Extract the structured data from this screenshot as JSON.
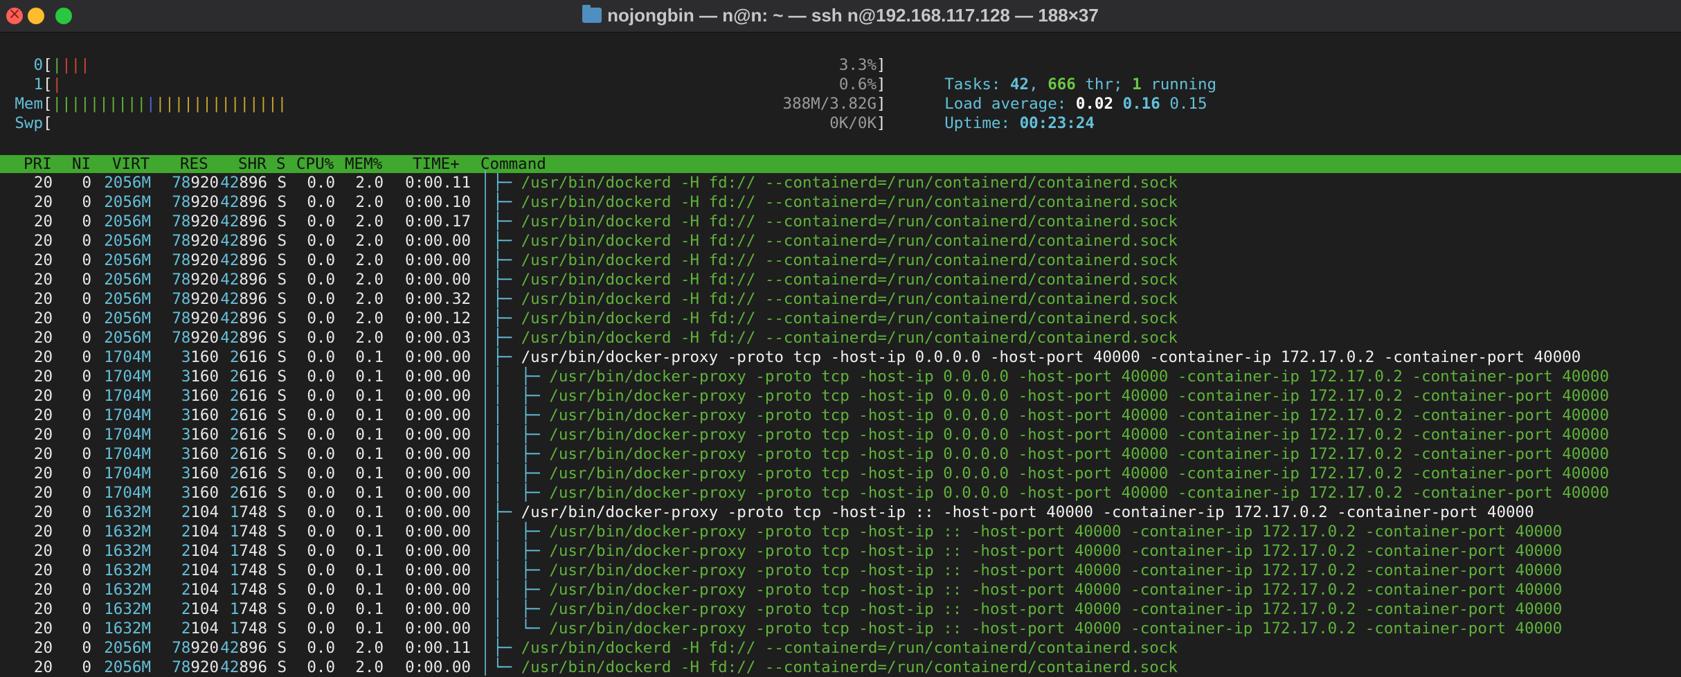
{
  "window": {
    "title": "nojongbin — n@n: ~ — ssh n@192.168.117.128 — 188×37"
  },
  "meters": [
    {
      "label": "0",
      "bars": [
        {
          "c": "g",
          "n": 1
        },
        {
          "c": "r",
          "n": 3
        }
      ],
      "value": "3.3%"
    },
    {
      "label": "1",
      "bars": [
        {
          "c": "r",
          "n": 1
        }
      ],
      "value": "0.6%"
    },
    {
      "label": "Mem",
      "bars": [
        {
          "c": "g",
          "n": 10
        },
        {
          "c": "b",
          "n": 1
        },
        {
          "c": "y",
          "n": 14
        }
      ],
      "value": "388M/3.82G"
    },
    {
      "label": "Swp",
      "bars": [],
      "value": "0K/0K"
    }
  ],
  "summary": {
    "tasks_label": "Tasks: ",
    "tasks": "42",
    "sep1": ", ",
    "threads": "666",
    "thr_label": " thr; ",
    "running": "1",
    "running_label": " running",
    "load_label": "Load average: ",
    "load1": "0.02",
    "load5": "0.16",
    "load15": "0.15",
    "uptime_label": "Uptime: ",
    "uptime": "00:23:24"
  },
  "columns": [
    "PRI",
    "NI",
    "VIRT",
    "RES",
    "SHR",
    "S",
    "CPU%",
    "MEM%",
    "TIME+",
    "Command"
  ],
  "processes": [
    {
      "pri": "20",
      "ni": "0",
      "virt": "2056M",
      "res_hi": "78",
      "res_lo": "920",
      "shr_hi": "42",
      "shr_lo": "896",
      "s": "S",
      "cpu": "0.0",
      "mem": "2.0",
      "time": "0:00.11",
      "tree": "├─ ",
      "cmd": "/usr/bin/dockerd -H fd:// --containerd=/run/containerd/containerd.sock",
      "style": "g"
    },
    {
      "pri": "20",
      "ni": "0",
      "virt": "2056M",
      "res_hi": "78",
      "res_lo": "920",
      "shr_hi": "42",
      "shr_lo": "896",
      "s": "S",
      "cpu": "0.0",
      "mem": "2.0",
      "time": "0:00.10",
      "tree": "├─ ",
      "cmd": "/usr/bin/dockerd -H fd:// --containerd=/run/containerd/containerd.sock",
      "style": "g"
    },
    {
      "pri": "20",
      "ni": "0",
      "virt": "2056M",
      "res_hi": "78",
      "res_lo": "920",
      "shr_hi": "42",
      "shr_lo": "896",
      "s": "S",
      "cpu": "0.0",
      "mem": "2.0",
      "time": "0:00.17",
      "tree": "├─ ",
      "cmd": "/usr/bin/dockerd -H fd:// --containerd=/run/containerd/containerd.sock",
      "style": "g"
    },
    {
      "pri": "20",
      "ni": "0",
      "virt": "2056M",
      "res_hi": "78",
      "res_lo": "920",
      "shr_hi": "42",
      "shr_lo": "896",
      "s": "S",
      "cpu": "0.0",
      "mem": "2.0",
      "time": "0:00.00",
      "tree": "├─ ",
      "cmd": "/usr/bin/dockerd -H fd:// --containerd=/run/containerd/containerd.sock",
      "style": "g"
    },
    {
      "pri": "20",
      "ni": "0",
      "virt": "2056M",
      "res_hi": "78",
      "res_lo": "920",
      "shr_hi": "42",
      "shr_lo": "896",
      "s": "S",
      "cpu": "0.0",
      "mem": "2.0",
      "time": "0:00.00",
      "tree": "├─ ",
      "cmd": "/usr/bin/dockerd -H fd:// --containerd=/run/containerd/containerd.sock",
      "style": "g"
    },
    {
      "pri": "20",
      "ni": "0",
      "virt": "2056M",
      "res_hi": "78",
      "res_lo": "920",
      "shr_hi": "42",
      "shr_lo": "896",
      "s": "S",
      "cpu": "0.0",
      "mem": "2.0",
      "time": "0:00.00",
      "tree": "├─ ",
      "cmd": "/usr/bin/dockerd -H fd:// --containerd=/run/containerd/containerd.sock",
      "style": "g"
    },
    {
      "pri": "20",
      "ni": "0",
      "virt": "2056M",
      "res_hi": "78",
      "res_lo": "920",
      "shr_hi": "42",
      "shr_lo": "896",
      "s": "S",
      "cpu": "0.0",
      "mem": "2.0",
      "time": "0:00.32",
      "tree": "├─ ",
      "cmd": "/usr/bin/dockerd -H fd:// --containerd=/run/containerd/containerd.sock",
      "style": "g"
    },
    {
      "pri": "20",
      "ni": "0",
      "virt": "2056M",
      "res_hi": "78",
      "res_lo": "920",
      "shr_hi": "42",
      "shr_lo": "896",
      "s": "S",
      "cpu": "0.0",
      "mem": "2.0",
      "time": "0:00.12",
      "tree": "├─ ",
      "cmd": "/usr/bin/dockerd -H fd:// --containerd=/run/containerd/containerd.sock",
      "style": "g"
    },
    {
      "pri": "20",
      "ni": "0",
      "virt": "2056M",
      "res_hi": "78",
      "res_lo": "920",
      "shr_hi": "42",
      "shr_lo": "896",
      "s": "S",
      "cpu": "0.0",
      "mem": "2.0",
      "time": "0:00.03",
      "tree": "├─ ",
      "cmd": "/usr/bin/dockerd -H fd:// --containerd=/run/containerd/containerd.sock",
      "style": "g"
    },
    {
      "pri": "20",
      "ni": "0",
      "virt": "1704M",
      "res_hi": "3",
      "res_lo": "160",
      "shr_hi": "2",
      "shr_lo": "616",
      "s": "S",
      "cpu": "0.0",
      "mem": "0.1",
      "time": "0:00.00",
      "tree": "├─ ",
      "cmd": "/usr/bin/docker-proxy -proto tcp -host-ip 0.0.0.0 -host-port 40000 -container-ip 172.17.0.2 -container-port 40000",
      "style": "w"
    },
    {
      "pri": "20",
      "ni": "0",
      "virt": "1704M",
      "res_hi": "3",
      "res_lo": "160",
      "shr_hi": "2",
      "shr_lo": "616",
      "s": "S",
      "cpu": "0.0",
      "mem": "0.1",
      "time": "0:00.00",
      "tree": "│  ├─ ",
      "cmd": "/usr/bin/docker-proxy -proto tcp -host-ip 0.0.0.0 -host-port 40000 -container-ip 172.17.0.2 -container-port 40000",
      "style": "g"
    },
    {
      "pri": "20",
      "ni": "0",
      "virt": "1704M",
      "res_hi": "3",
      "res_lo": "160",
      "shr_hi": "2",
      "shr_lo": "616",
      "s": "S",
      "cpu": "0.0",
      "mem": "0.1",
      "time": "0:00.00",
      "tree": "│  ├─ ",
      "cmd": "/usr/bin/docker-proxy -proto tcp -host-ip 0.0.0.0 -host-port 40000 -container-ip 172.17.0.2 -container-port 40000",
      "style": "g"
    },
    {
      "pri": "20",
      "ni": "0",
      "virt": "1704M",
      "res_hi": "3",
      "res_lo": "160",
      "shr_hi": "2",
      "shr_lo": "616",
      "s": "S",
      "cpu": "0.0",
      "mem": "0.1",
      "time": "0:00.00",
      "tree": "│  ├─ ",
      "cmd": "/usr/bin/docker-proxy -proto tcp -host-ip 0.0.0.0 -host-port 40000 -container-ip 172.17.0.2 -container-port 40000",
      "style": "g"
    },
    {
      "pri": "20",
      "ni": "0",
      "virt": "1704M",
      "res_hi": "3",
      "res_lo": "160",
      "shr_hi": "2",
      "shr_lo": "616",
      "s": "S",
      "cpu": "0.0",
      "mem": "0.1",
      "time": "0:00.00",
      "tree": "│  ├─ ",
      "cmd": "/usr/bin/docker-proxy -proto tcp -host-ip 0.0.0.0 -host-port 40000 -container-ip 172.17.0.2 -container-port 40000",
      "style": "g"
    },
    {
      "pri": "20",
      "ni": "0",
      "virt": "1704M",
      "res_hi": "3",
      "res_lo": "160",
      "shr_hi": "2",
      "shr_lo": "616",
      "s": "S",
      "cpu": "0.0",
      "mem": "0.1",
      "time": "0:00.00",
      "tree": "│  ├─ ",
      "cmd": "/usr/bin/docker-proxy -proto tcp -host-ip 0.0.0.0 -host-port 40000 -container-ip 172.17.0.2 -container-port 40000",
      "style": "g"
    },
    {
      "pri": "20",
      "ni": "0",
      "virt": "1704M",
      "res_hi": "3",
      "res_lo": "160",
      "shr_hi": "2",
      "shr_lo": "616",
      "s": "S",
      "cpu": "0.0",
      "mem": "0.1",
      "time": "0:00.00",
      "tree": "│  ├─ ",
      "cmd": "/usr/bin/docker-proxy -proto tcp -host-ip 0.0.0.0 -host-port 40000 -container-ip 172.17.0.2 -container-port 40000",
      "style": "g"
    },
    {
      "pri": "20",
      "ni": "0",
      "virt": "1704M",
      "res_hi": "3",
      "res_lo": "160",
      "shr_hi": "2",
      "shr_lo": "616",
      "s": "S",
      "cpu": "0.0",
      "mem": "0.1",
      "time": "0:00.00",
      "tree": "│  ├─ ",
      "cmd": "/usr/bin/docker-proxy -proto tcp -host-ip 0.0.0.0 -host-port 40000 -container-ip 172.17.0.2 -container-port 40000",
      "style": "g"
    },
    {
      "pri": "20",
      "ni": "0",
      "virt": "1632M",
      "res_hi": "2",
      "res_lo": "104",
      "shr_hi": "1",
      "shr_lo": "748",
      "s": "S",
      "cpu": "0.0",
      "mem": "0.1",
      "time": "0:00.00",
      "tree": "├─ ",
      "cmd": "/usr/bin/docker-proxy -proto tcp -host-ip :: -host-port 40000 -container-ip 172.17.0.2 -container-port 40000",
      "style": "w"
    },
    {
      "pri": "20",
      "ni": "0",
      "virt": "1632M",
      "res_hi": "2",
      "res_lo": "104",
      "shr_hi": "1",
      "shr_lo": "748",
      "s": "S",
      "cpu": "0.0",
      "mem": "0.1",
      "time": "0:00.00",
      "tree": "│  ├─ ",
      "cmd": "/usr/bin/docker-proxy -proto tcp -host-ip :: -host-port 40000 -container-ip 172.17.0.2 -container-port 40000",
      "style": "g"
    },
    {
      "pri": "20",
      "ni": "0",
      "virt": "1632M",
      "res_hi": "2",
      "res_lo": "104",
      "shr_hi": "1",
      "shr_lo": "748",
      "s": "S",
      "cpu": "0.0",
      "mem": "0.1",
      "time": "0:00.00",
      "tree": "│  ├─ ",
      "cmd": "/usr/bin/docker-proxy -proto tcp -host-ip :: -host-port 40000 -container-ip 172.17.0.2 -container-port 40000",
      "style": "g"
    },
    {
      "pri": "20",
      "ni": "0",
      "virt": "1632M",
      "res_hi": "2",
      "res_lo": "104",
      "shr_hi": "1",
      "shr_lo": "748",
      "s": "S",
      "cpu": "0.0",
      "mem": "0.1",
      "time": "0:00.00",
      "tree": "│  ├─ ",
      "cmd": "/usr/bin/docker-proxy -proto tcp -host-ip :: -host-port 40000 -container-ip 172.17.0.2 -container-port 40000",
      "style": "g"
    },
    {
      "pri": "20",
      "ni": "0",
      "virt": "1632M",
      "res_hi": "2",
      "res_lo": "104",
      "shr_hi": "1",
      "shr_lo": "748",
      "s": "S",
      "cpu": "0.0",
      "mem": "0.1",
      "time": "0:00.00",
      "tree": "│  ├─ ",
      "cmd": "/usr/bin/docker-proxy -proto tcp -host-ip :: -host-port 40000 -container-ip 172.17.0.2 -container-port 40000",
      "style": "g"
    },
    {
      "pri": "20",
      "ni": "0",
      "virt": "1632M",
      "res_hi": "2",
      "res_lo": "104",
      "shr_hi": "1",
      "shr_lo": "748",
      "s": "S",
      "cpu": "0.0",
      "mem": "0.1",
      "time": "0:00.00",
      "tree": "│  ├─ ",
      "cmd": "/usr/bin/docker-proxy -proto tcp -host-ip :: -host-port 40000 -container-ip 172.17.0.2 -container-port 40000",
      "style": "g"
    },
    {
      "pri": "20",
      "ni": "0",
      "virt": "1632M",
      "res_hi": "2",
      "res_lo": "104",
      "shr_hi": "1",
      "shr_lo": "748",
      "s": "S",
      "cpu": "0.0",
      "mem": "0.1",
      "time": "0:00.00",
      "tree": "│  └─ ",
      "cmd": "/usr/bin/docker-proxy -proto tcp -host-ip :: -host-port 40000 -container-ip 172.17.0.2 -container-port 40000",
      "style": "g"
    },
    {
      "pri": "20",
      "ni": "0",
      "virt": "2056M",
      "res_hi": "78",
      "res_lo": "920",
      "shr_hi": "42",
      "shr_lo": "896",
      "s": "S",
      "cpu": "0.0",
      "mem": "2.0",
      "time": "0:00.11",
      "tree": "├─ ",
      "cmd": "/usr/bin/dockerd -H fd:// --containerd=/run/containerd/containerd.sock",
      "style": "g"
    },
    {
      "pri": "20",
      "ni": "0",
      "virt": "2056M",
      "res_hi": "78",
      "res_lo": "920",
      "shr_hi": "42",
      "shr_lo": "896",
      "s": "S",
      "cpu": "0.0",
      "mem": "2.0",
      "time": "0:00.00",
      "tree": "└─ ",
      "cmd": "/usr/bin/dockerd -H fd:// --containerd=/run/containerd/containerd.sock",
      "style": "g"
    }
  ]
}
